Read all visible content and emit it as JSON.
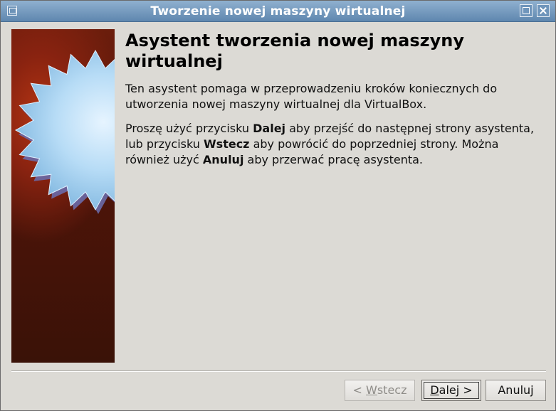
{
  "window": {
    "title": "Tworzenie nowej maszyny wirtualnej"
  },
  "content": {
    "heading": "Asystent tworzenia nowej maszyny wirtualnej",
    "paragraph1": "Ten asystent pomaga w przeprowadzeniu kroków koniecznych do utworzenia nowej maszyny wirtualnej dla VirtualBox.",
    "paragraph2": {
      "part1": "Proszę użyć przycisku ",
      "bold1": "Dalej",
      "part2": " aby przejść do następnej strony asystenta, lub przycisku ",
      "bold2": "Wstecz",
      "part3": " aby powrócić do poprzedniej strony. Można również użyć ",
      "bold3": "Anuluj",
      "part4": " aby przerwać pracę asystenta."
    }
  },
  "buttons": {
    "back": {
      "prefix": "< ",
      "mnemonic": "W",
      "rest": "stecz",
      "enabled": false
    },
    "next": {
      "mnemonic": "D",
      "rest": "alej >",
      "enabled": true,
      "focused": true
    },
    "cancel": {
      "label": "Anuluj",
      "enabled": true
    }
  },
  "icons": {
    "app": "virtualbox-window-icon",
    "maximize": "maximize-icon",
    "close": "close-icon",
    "side": "wizard-starburst-image"
  },
  "colors": {
    "titlebar": "#6f95bb",
    "side_image_dark": "#3a1207",
    "side_image_accent": "#b23413",
    "starburst": "#a9d3f0"
  }
}
